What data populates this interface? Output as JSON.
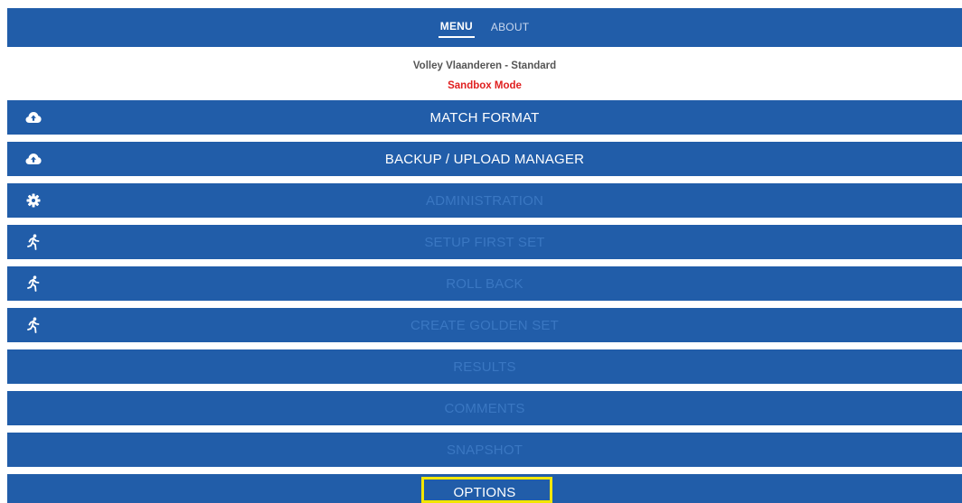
{
  "tabs": {
    "menu": "MENU",
    "about": "ABOUT"
  },
  "header": {
    "league": "Volley Vlaanderen - Standard",
    "mode": "Sandbox Mode"
  },
  "menu": {
    "items": [
      {
        "label": "MATCH FORMAT",
        "icon": "cloud-upload-icon",
        "enabled": true
      },
      {
        "label": "BACKUP / UPLOAD MANAGER",
        "icon": "cloud-upload-icon",
        "enabled": true
      },
      {
        "label": "ADMINISTRATION",
        "icon": "gear-icon",
        "enabled": false
      },
      {
        "label": "SETUP FIRST SET",
        "icon": "running-person-icon",
        "enabled": false
      },
      {
        "label": "ROLL BACK",
        "icon": "running-person-icon",
        "enabled": false
      },
      {
        "label": "CREATE GOLDEN SET",
        "icon": "running-person-icon",
        "enabled": false
      },
      {
        "label": "RESULTS",
        "icon": "",
        "enabled": false
      },
      {
        "label": "COMMENTS",
        "icon": "",
        "enabled": false
      },
      {
        "label": "SNAPSHOT",
        "icon": "",
        "enabled": false
      },
      {
        "label": "OPTIONS",
        "icon": "",
        "enabled": true
      }
    ]
  },
  "colors": {
    "bar": "#215da9",
    "disabled_text": "#3a77c2",
    "mode_text": "#e02020",
    "highlight": "#f2e600"
  }
}
